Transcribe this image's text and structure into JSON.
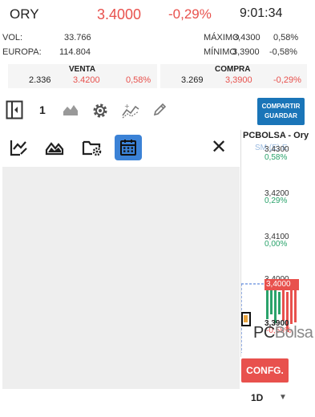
{
  "header": {
    "ticker": "ORY",
    "price": "3.4000",
    "change": "-0,29%",
    "time": "9:01:34"
  },
  "stats": {
    "vol_label": "VOL:",
    "vol_value": "33.766",
    "europa_label": "EUROPA:",
    "europa_value": "114.804",
    "max_label": "MÁXIMO",
    "max_value": "3,4300",
    "max_pct": "0,58%",
    "min_label": "MÍNIMO",
    "min_value": "3,3900",
    "min_pct": "-0,58%"
  },
  "book": {
    "sell_label": "VENTA",
    "sell_qty": "2.336",
    "sell_price": "3.4200",
    "sell_pct": "0,58%",
    "buy_label": "COMPRA",
    "buy_qty": "3.269",
    "buy_price": "3,3900",
    "buy_pct": "-0,29%"
  },
  "toolbar": {
    "count": "1",
    "save_label_1": "COMPARTIR",
    "save_label_2": "GUARDAR"
  },
  "chart_panel": {
    "title": "PCBOLSA - Ory",
    "subtitle": "SM (E) E",
    "ticks": [
      {
        "price": "3,4300",
        "pct": "0,58%"
      },
      {
        "price": "3,4200",
        "pct": "0,29%"
      },
      {
        "price": "3,4100",
        "pct": "0,00%"
      },
      {
        "price": "3,4000",
        "pct": ""
      }
    ],
    "current_tag": "3,4000",
    "low_value": "3,3900",
    "low_pct": "-0,58%",
    "brand_bold": "PC",
    "brand_light": "Bolsa"
  },
  "controls": {
    "config_label": "CONFG.",
    "interval": "1D"
  },
  "colors": {
    "accent_blue": "#1a75b8",
    "down_red": "#e8514d",
    "up_green": "#2aa36b",
    "calendar_blue": "#3b82d6"
  }
}
